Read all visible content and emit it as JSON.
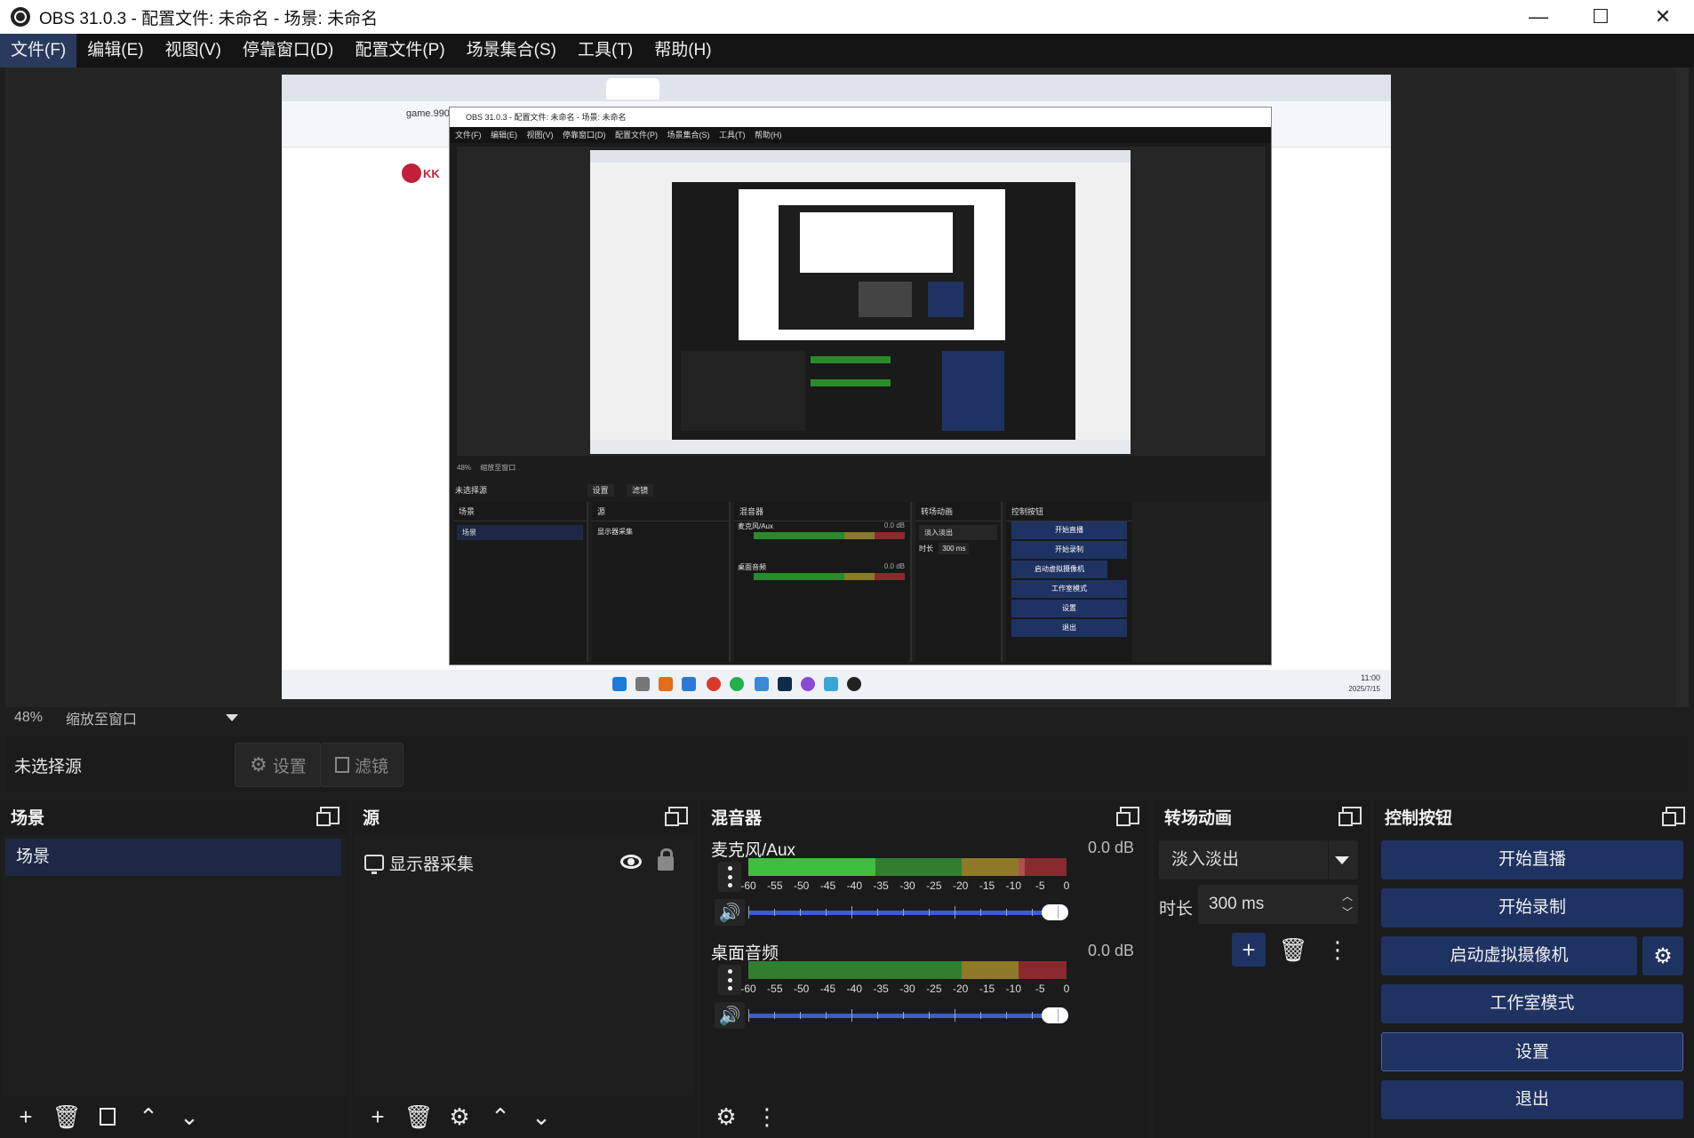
{
  "window": {
    "title": "OBS 31.0.3 - 配置文件: 未命名 - 场景: 未命名",
    "minimize": "—",
    "maximize": "☐",
    "close": "✕"
  },
  "menu": [
    "文件(F)",
    "编辑(E)",
    "视图(V)",
    "停靠窗口(D)",
    "配置文件(P)",
    "场景集合(S)",
    "工具(T)",
    "帮助(H)"
  ],
  "preview_inner": {
    "title": "OBS 31.0.3 - 配置文件: 未命名 - 场景: 未命名",
    "menu": "文件(F) 编辑(E) 视图(V) 停靠窗口(D) 配置文件(P) 场景集合(S) 工具(T) 帮助(H)",
    "url": "game.990",
    "logo_text": "KK",
    "zoom": "48%",
    "zoom_mode": "缩放至窗口",
    "no_source": "未选择源",
    "settings": "设置",
    "filters": "滤镜",
    "docks": [
      "场景",
      "源",
      "混音器",
      "转场动画",
      "控制按钮"
    ],
    "scene": "场景",
    "source": "显示器采集",
    "mic": "麦克风/Aux",
    "desktop": "桌面音频",
    "db": "0.0 dB",
    "transition": "淡入淡出",
    "duration_label": "时长",
    "duration": "300 ms",
    "buttons": [
      "开始直播",
      "开始录制",
      "启动虚拟摄像机",
      "工作室模式",
      "设置",
      "退出"
    ],
    "clock_time": "11:00",
    "clock_date": "2025/7/15"
  },
  "zoom": {
    "percent": "48%",
    "mode": "缩放至窗口"
  },
  "source_toolbar": {
    "no_source": "未选择源",
    "settings": "设置",
    "filters": "滤镜"
  },
  "scenes": {
    "title": "场景",
    "items": [
      "场景"
    ]
  },
  "sources": {
    "title": "源",
    "items": [
      {
        "name": "显示器采集"
      }
    ]
  },
  "mixer": {
    "title": "混音器",
    "channels": [
      {
        "name": "麦克风/Aux",
        "db": "0.0 dB"
      },
      {
        "name": "桌面音频",
        "db": "0.0 dB"
      }
    ],
    "ticks": [
      "-60",
      "-55",
      "-50",
      "-45",
      "-40",
      "-35",
      "-30",
      "-25",
      "-20",
      "-15",
      "-10",
      "-5",
      "0"
    ]
  },
  "transitions": {
    "title": "转场动画",
    "selected": "淡入淡出",
    "duration_label": "时长",
    "duration": "300 ms"
  },
  "controls": {
    "title": "控制按钮",
    "start_stream": "开始直播",
    "start_record": "开始录制",
    "virtual_cam": "启动虚拟摄像机",
    "studio_mode": "工作室模式",
    "settings": "设置",
    "exit": "退出"
  },
  "colors": {
    "button_blue": "#1f3363",
    "meter_green": "#3fbf3f",
    "meter_yellow": "#c9a52c",
    "meter_red": "#c4323a",
    "volume_blue": "#3d5ec8"
  }
}
